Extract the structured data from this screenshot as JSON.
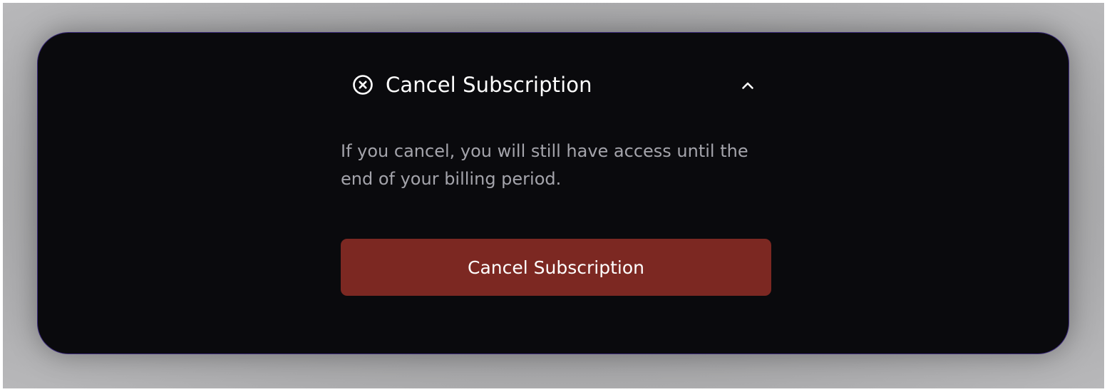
{
  "section": {
    "title": "Cancel Subscription",
    "icon": "x-circle-icon",
    "toggle_icon": "chevron-up-icon",
    "description": "If you cancel, you will still have access until the end of your billing period.",
    "action_label": "Cancel Subscription"
  },
  "colors": {
    "card_background": "#0a0a0d",
    "card_border": "#3b2a7a",
    "danger_button": "#7c2822",
    "muted_text": "#a4a4ab",
    "title_text": "#ffffff"
  }
}
